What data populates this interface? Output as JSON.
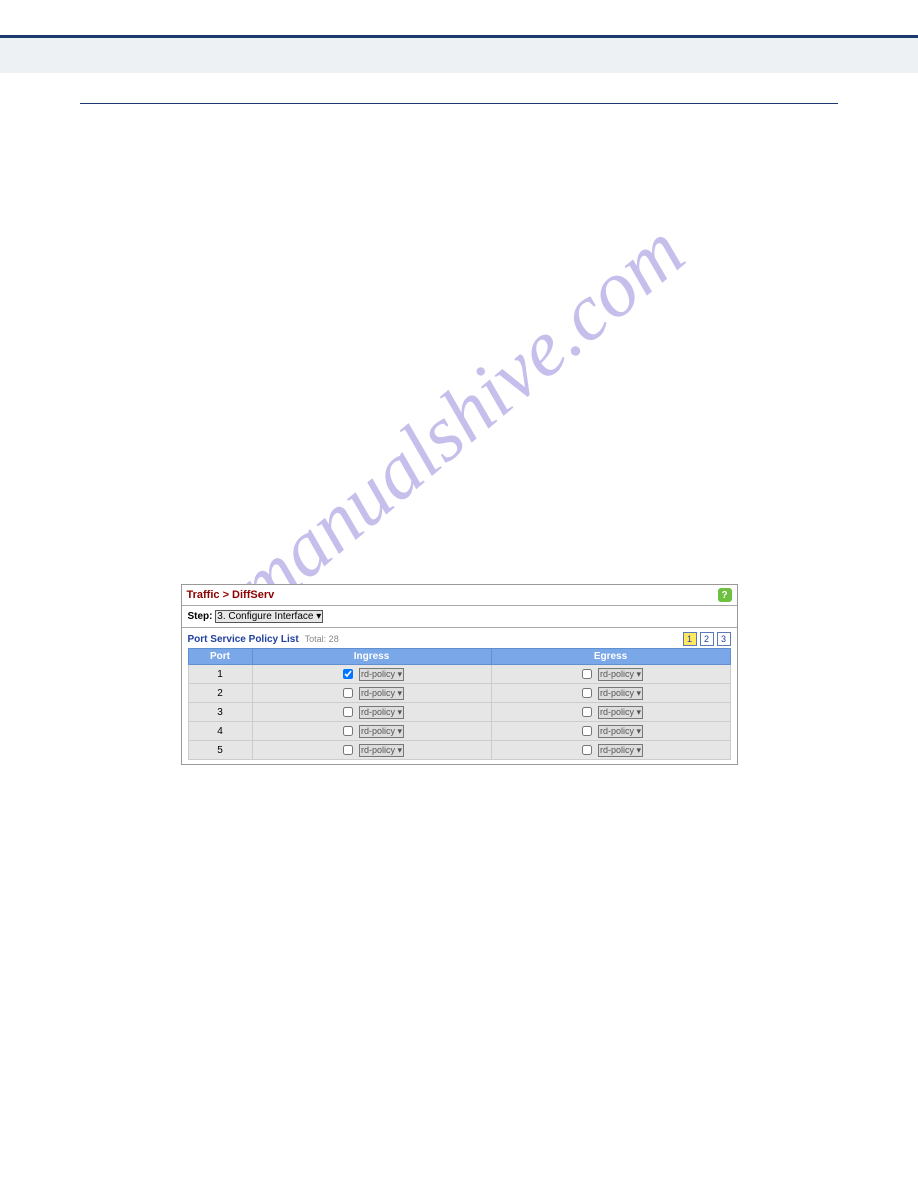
{
  "watermark": "manualshive.com",
  "screenshot": {
    "breadcrumb": "Traffic > DiffServ",
    "step_label": "Step:",
    "step_value": "3. Configure Interface",
    "list_title": "Port Service Policy List",
    "list_total": "Total: 28",
    "pager": [
      "1",
      "2",
      "3"
    ],
    "columns": [
      "Port",
      "Ingress",
      "Egress"
    ],
    "rows": [
      {
        "port": "1",
        "ingress_checked": true,
        "ingress_policy": "rd-policy",
        "egress_checked": false,
        "egress_policy": "rd-policy"
      },
      {
        "port": "2",
        "ingress_checked": false,
        "ingress_policy": "rd-policy",
        "egress_checked": false,
        "egress_policy": "rd-policy"
      },
      {
        "port": "3",
        "ingress_checked": false,
        "ingress_policy": "rd-policy",
        "egress_checked": false,
        "egress_policy": "rd-policy"
      },
      {
        "port": "4",
        "ingress_checked": false,
        "ingress_policy": "rd-policy",
        "egress_checked": false,
        "egress_policy": "rd-policy"
      },
      {
        "port": "5",
        "ingress_checked": false,
        "ingress_policy": "rd-policy",
        "egress_checked": false,
        "egress_policy": "rd-policy"
      }
    ]
  }
}
